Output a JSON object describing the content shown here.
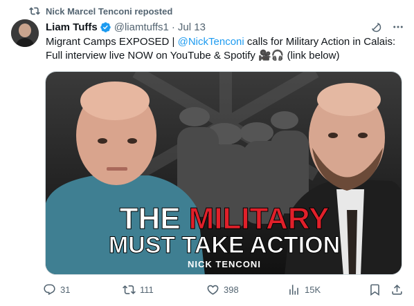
{
  "repost": {
    "text": "Nick Marcel Tenconi reposted"
  },
  "tweet": {
    "author_name": "Liam Tuffs",
    "handle": "@liamtuffs1",
    "separator": "·",
    "date": "Jul 13",
    "text_part1": "Migrant Camps EXPOSED | ",
    "mention": "@NickTenconi",
    "text_part2": " calls for Military Action in Calais: Full interview live NOW on YouTube & Spotify 🎥🎧 (link below)"
  },
  "thumbnail": {
    "headline_word1": "THE",
    "headline_word2": "MILITARY",
    "headline_line2": "MUST TAKE ACTION",
    "caption": "NICK TENCONI"
  },
  "actions": {
    "replies": "31",
    "reposts": "111",
    "likes": "398",
    "views": "15K"
  },
  "colors": {
    "accent": "#1d9bf0",
    "secondary_text": "#536471",
    "headline_red": "#e0202a"
  },
  "icons": [
    "repost-icon",
    "verified-badge-icon",
    "grok-icon",
    "more-icon",
    "reply-icon",
    "retweet-icon",
    "like-icon",
    "views-icon",
    "bookmark-icon",
    "share-icon"
  ]
}
